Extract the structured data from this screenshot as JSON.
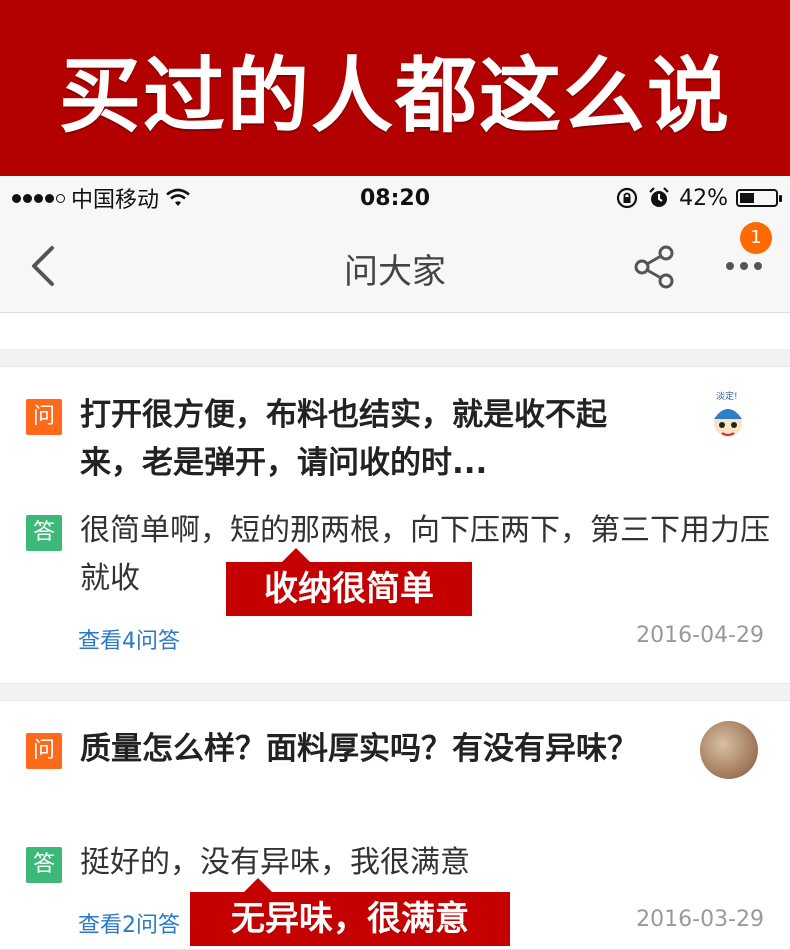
{
  "banner": {
    "title": "买过的人都这么说"
  },
  "status_bar": {
    "carrier": "中国移动",
    "time": "08:20",
    "battery": "42%",
    "battery_level": 0.42
  },
  "nav": {
    "title": "问大家",
    "badge_count": "1"
  },
  "questions": [
    {
      "tag_q": "问",
      "question": "打开很方便，布料也结实，就是收不起来，老是弹开，请问收的时...",
      "tag_a": "答",
      "answer": "很简单啊，短的那两根，向下压两下，第三下用力压就收",
      "link": "查看4问答",
      "date": "2016-04-29",
      "callout": "收纳很简单"
    },
    {
      "tag_q": "问",
      "question": "质量怎么样？面料厚实吗？有没有异味？",
      "tag_a": "答",
      "answer": "挺好的，没有异味，我很满意",
      "link": "查看2问答",
      "date": "2016-03-29",
      "callout": "无异味，很满意"
    }
  ],
  "colors": {
    "banner": "#b30000",
    "callout": "#c40000",
    "q_tag": "#ff6a1a",
    "a_tag": "#3cb878",
    "link": "#2a78c8"
  }
}
